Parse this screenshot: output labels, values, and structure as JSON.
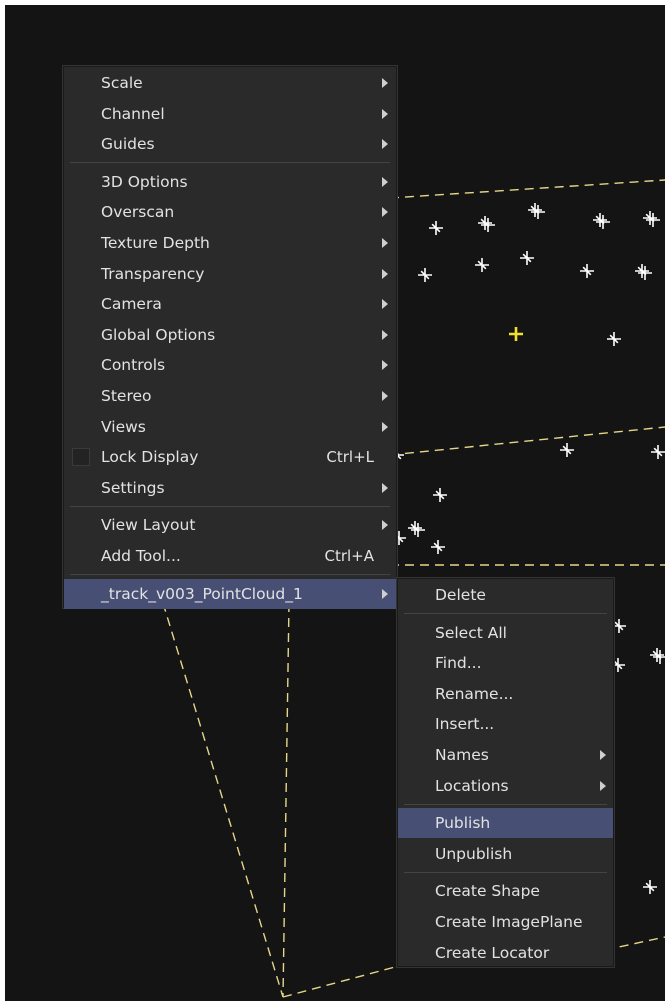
{
  "main_menu": {
    "groups": [
      [
        {
          "label": "Scale",
          "submenu": true
        },
        {
          "label": "Channel",
          "submenu": true
        },
        {
          "label": "Guides",
          "submenu": true
        }
      ],
      [
        {
          "label": "3D Options",
          "submenu": true
        },
        {
          "label": "Overscan",
          "submenu": true
        },
        {
          "label": "Texture Depth",
          "submenu": true
        },
        {
          "label": "Transparency",
          "submenu": true
        },
        {
          "label": "Camera",
          "submenu": true
        },
        {
          "label": "Global Options",
          "submenu": true
        },
        {
          "label": "Controls",
          "submenu": true
        },
        {
          "label": "Stereo",
          "submenu": true
        },
        {
          "label": "Views",
          "submenu": true
        },
        {
          "label": "Lock Display",
          "shortcut": "Ctrl+L",
          "checkbox": true,
          "checked": false
        },
        {
          "label": "Settings",
          "submenu": true
        }
      ],
      [
        {
          "label": "View Layout",
          "submenu": true
        },
        {
          "label": "Add Tool...",
          "shortcut": "Ctrl+A"
        }
      ],
      [
        {
          "label": "_track_v003_PointCloud_1",
          "submenu": true,
          "highlighted": true
        }
      ]
    ]
  },
  "sub_menu": {
    "groups": [
      [
        {
          "label": "Delete"
        }
      ],
      [
        {
          "label": "Select All"
        },
        {
          "label": "Find..."
        },
        {
          "label": "Rename..."
        },
        {
          "label": "Insert..."
        },
        {
          "label": "Names",
          "submenu": true
        },
        {
          "label": "Locations",
          "submenu": true
        }
      ],
      [
        {
          "label": "Publish",
          "highlighted": true
        },
        {
          "label": "Unpublish"
        }
      ],
      [
        {
          "label": "Create Shape"
        },
        {
          "label": "Create ImagePlane"
        },
        {
          "label": "Create Locator"
        }
      ]
    ]
  },
  "colors": {
    "viewport_bg": "#141414",
    "menu_bg": "#2a2a2a",
    "highlight": "#474f74",
    "guide_line": "#e6d68a",
    "point_marker": "#ffffff",
    "selected_point": "#f2e12a"
  }
}
